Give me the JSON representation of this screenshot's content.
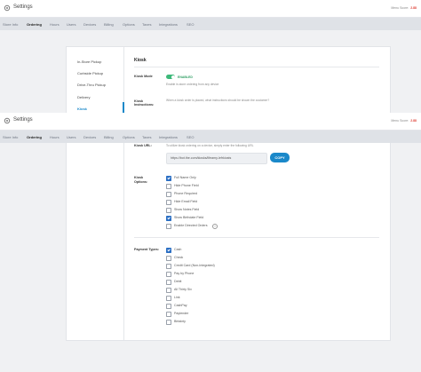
{
  "app": {
    "title": "Settings",
    "menu_label": "Menu Score:",
    "menu_score_top": "2.88",
    "menu_score_bottom": "2.88"
  },
  "tabs": [
    "Store Info",
    "Ordering",
    "Hours",
    "Users",
    "Devices",
    "Billing",
    "Options",
    "Taxes",
    "Integrations",
    "SEO"
  ],
  "active_tab": "Ordering",
  "sidebar": {
    "items": [
      "In-Store Pickup",
      "Curbside Pickup",
      "Drive-Thru Pickup",
      "Delivery",
      "Kiosk"
    ],
    "active": "Kiosk"
  },
  "kiosk": {
    "heading": "Kiosk",
    "mode_label": "Kiosk Mode",
    "mode_status": "ENABLED",
    "mode_help": "Enable in-store ordering from any device",
    "instructions_label": "Kiosk Instructions:",
    "instructions_help": "When a kiosk order is placed, what instructions should be shown the customer?",
    "url_label": "Kiosk URL:",
    "url_help": "To utilize kiosk ordering on a device, simply enter the following URL",
    "url_value": "https://bot.the.com/kiosks/lifeamy-lefrkiosts",
    "copy_label": "COPY",
    "options_label": "Kiosk Options:",
    "options": [
      {
        "label": "Full Name Only",
        "checked": true
      },
      {
        "label": "Hide Phone Field",
        "checked": false
      },
      {
        "label": "Phone Required",
        "checked": false
      },
      {
        "label": "Hide Email Field",
        "checked": false
      },
      {
        "label": "Show Notes Field",
        "checked": false
      },
      {
        "label": "Show Birthdate Field",
        "checked": true
      },
      {
        "label": "Enable Directed Orders",
        "checked": false,
        "info": "?"
      }
    ],
    "payment_label": "Payment Types:",
    "payments": [
      {
        "label": "Cash",
        "checked": true
      },
      {
        "label": "Check",
        "checked": false
      },
      {
        "label": "Credit Card (Non-Integrated)",
        "checked": false
      },
      {
        "label": "Pay by Phone",
        "checked": false
      },
      {
        "label": "Debit",
        "checked": false
      },
      {
        "label": "All Thirty Six",
        "checked": false
      },
      {
        "label": "Link",
        "checked": false
      },
      {
        "label": "CashPay",
        "checked": false
      },
      {
        "label": "Paytender",
        "checked": false
      },
      {
        "label": "Birtainty",
        "checked": false
      }
    ]
  }
}
